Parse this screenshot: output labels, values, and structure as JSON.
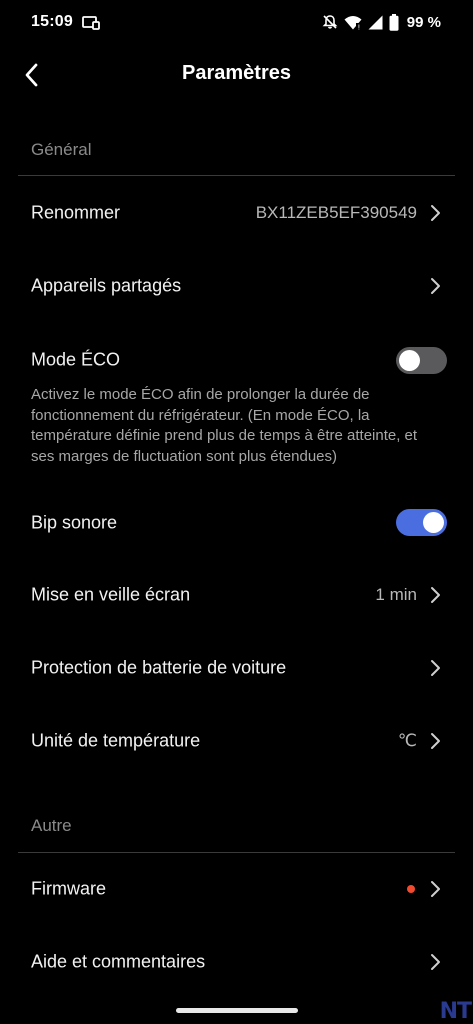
{
  "status_bar": {
    "time": "15:09",
    "battery": "99 %",
    "icons": [
      "cast-icon",
      "dnd-bell-off-icon",
      "wifi-icon",
      "signal-icon",
      "battery-icon"
    ]
  },
  "header": {
    "title": "Paramètres",
    "back_icon": "chevron-left-icon"
  },
  "sections": {
    "general": {
      "title": "Général"
    },
    "other": {
      "title": "Autre"
    }
  },
  "rows": {
    "rename": {
      "label": "Renommer",
      "value": "BX11ZEB5EF390549"
    },
    "shared_devices": {
      "label": "Appareils partagés"
    },
    "eco_mode": {
      "label": "Mode ÉCO",
      "enabled": false,
      "description": "Activez le mode ÉCO afin de prolonger la durée de fonctionnement du réfrigérateur. (En mode ÉCO, la température définie prend plus de temps à être atteinte, et ses marges de fluctuation sont plus étendues)"
    },
    "beep": {
      "label": "Bip sonore",
      "enabled": true
    },
    "screen_sleep": {
      "label": "Mise en veille écran",
      "value": "1 min"
    },
    "battery_protection": {
      "label": "Protection de batterie de voiture"
    },
    "temp_unit": {
      "label": "Unité de température",
      "value": "℃"
    },
    "firmware": {
      "label": "Firmware",
      "has_update_dot": true
    },
    "help": {
      "label": "Aide et commentaires"
    }
  },
  "colors": {
    "background": "#000000",
    "toggle_on": "#4a6ee0",
    "toggle_off": "#5a5a5c",
    "update_dot": "#f04a2f",
    "section_text": "#8a8a8a"
  },
  "watermark": "NT"
}
